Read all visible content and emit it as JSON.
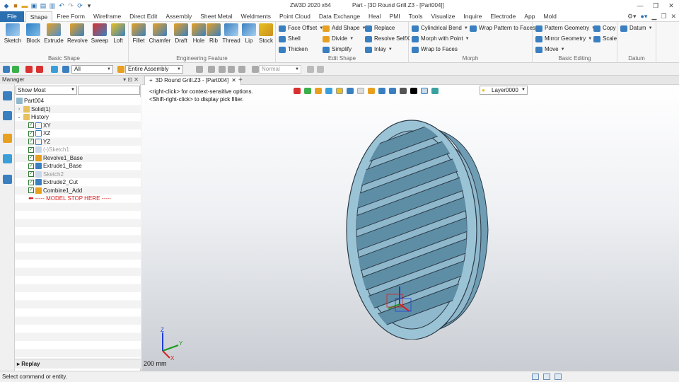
{
  "window": {
    "app_title": "ZW3D 2020 x64",
    "doc_title": "Part - [3D Round Grill.Z3 - [Part004]]"
  },
  "menu": {
    "tabs": [
      "File",
      "Shape",
      "Free Form",
      "Wireframe",
      "Direct Edit",
      "Assembly",
      "Sheet Metal",
      "Weldments",
      "Point Cloud",
      "Data Exchange",
      "Heal",
      "PMI",
      "Tools",
      "Visualize",
      "Inquire",
      "Electrode",
      "App",
      "Mold"
    ],
    "active": "Shape"
  },
  "ribbon": {
    "basic_shape": {
      "label": "Basic Shape",
      "buttons": [
        "Sketch",
        "Block",
        "Extrude",
        "Revolve",
        "Sweep",
        "Loft"
      ]
    },
    "engineering_feature": {
      "label": "Engineering Feature",
      "buttons": [
        "Fillet",
        "Chamfer",
        "Draft",
        "Hole",
        "Rib",
        "Thread",
        "Lip",
        "Stock"
      ]
    },
    "edit_shape": {
      "label": "Edit Shape",
      "col1": [
        "Face Offset",
        "Shell",
        "Thicken"
      ],
      "col2": [
        "Add Shape",
        "Divide",
        "Simplify"
      ],
      "col3": [
        "Replace",
        "Resolve SelfX",
        "Inlay"
      ]
    },
    "morph": {
      "label": "Morph",
      "col1": [
        "Cylindrical Bend",
        "Morph with Point",
        "Wrap to Faces"
      ],
      "col2": [
        "Wrap Pattern to Faces"
      ]
    },
    "basic_editing": {
      "label": "Basic Editing",
      "col1": [
        "Pattern Geometry",
        "Mirror Geometry",
        "Move"
      ],
      "col2": [
        "Copy",
        "Scale"
      ]
    },
    "datum": {
      "label": "Datum",
      "buttons": [
        "Datum"
      ]
    }
  },
  "toolbar": {
    "filter_value": "All",
    "assembly_value": "Entire Assembly",
    "render_value": "Normal"
  },
  "manager": {
    "title": "Manager",
    "filter_value": "Show Most",
    "tree": [
      {
        "label": "Part004",
        "level": 0,
        "check": false,
        "muted": false
      },
      {
        "label": "Solid(1)",
        "level": 1,
        "check": false,
        "muted": false
      },
      {
        "label": "History",
        "level": 1,
        "check": false,
        "muted": false
      },
      {
        "label": "XY",
        "level": 2,
        "check": true,
        "muted": false
      },
      {
        "label": "XZ",
        "level": 2,
        "check": true,
        "muted": false
      },
      {
        "label": "YZ",
        "level": 2,
        "check": true,
        "muted": false
      },
      {
        "label": "(-)Sketch1",
        "level": 2,
        "check": true,
        "muted": true
      },
      {
        "label": "Revolve1_Base",
        "level": 2,
        "check": true,
        "muted": false
      },
      {
        "label": "Extrude1_Base",
        "level": 2,
        "check": true,
        "muted": false
      },
      {
        "label": "Sketch2",
        "level": 2,
        "check": true,
        "muted": true
      },
      {
        "label": "Extrude2_Cut",
        "level": 2,
        "check": true,
        "muted": false
      },
      {
        "label": "Combine1_Add",
        "level": 2,
        "check": true,
        "muted": false
      },
      {
        "label": "----- MODEL STOP HERE -----",
        "level": 2,
        "check": false,
        "muted": false
      }
    ],
    "replay_label": "Replay"
  },
  "viewport": {
    "doc_tab": "3D Round Grill.Z3 - [Part004]",
    "hint_1": "<right-click> for context-sensitive options.",
    "hint_2": "<Shift-right-click> to display pick filter.",
    "layer": "Layer0000",
    "scale": "200 mm"
  },
  "status": {
    "text": "Select command or entity."
  },
  "colors": {
    "accent": "#2a6fb0",
    "part": "#8fb8cc",
    "part_dark": "#5e8ea6"
  }
}
